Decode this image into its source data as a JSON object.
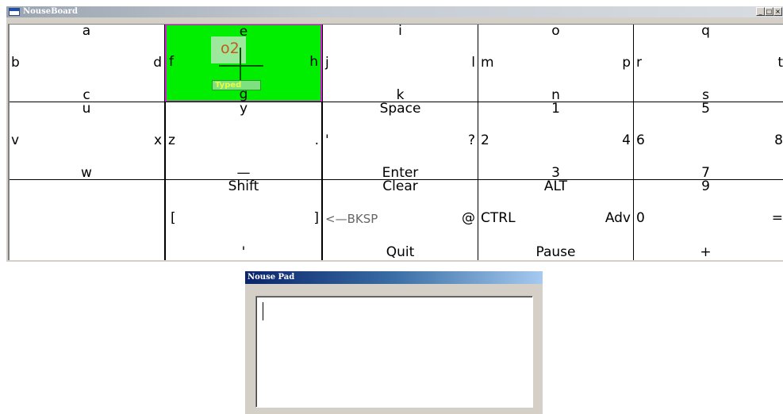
{
  "board_window": {
    "title": "NouseBoard",
    "controls": {
      "minimize": "_",
      "maximize": "□",
      "close": "×"
    }
  },
  "keyboard": {
    "rows": [
      [
        {
          "top": "a",
          "left": "b",
          "right": "d",
          "bottom": "c"
        },
        {
          "top": "e",
          "left": "f",
          "right": "h",
          "bottom": "g",
          "active": true
        },
        {
          "top": "i",
          "left": "j",
          "right": "l",
          "bottom": "k"
        },
        {
          "top": "o",
          "left": "m",
          "right": "p",
          "bottom": "n"
        },
        {
          "top": "q",
          "left": "r",
          "right": "t",
          "bottom": "s"
        }
      ],
      [
        {
          "top": "u",
          "left": "v",
          "right": "x",
          "bottom": "w"
        },
        {
          "top": "y",
          "left": "z",
          "right": ".",
          "bottom": "—"
        },
        {
          "top": "Space",
          "left": "'",
          "right": "?",
          "bottom": "Enter"
        },
        {
          "top": "1",
          "left": "2",
          "right": "4",
          "bottom": "3"
        },
        {
          "top": "5",
          "left": "6",
          "right": "8",
          "bottom": "7"
        }
      ],
      [
        {
          "top": "",
          "left": "",
          "right": "",
          "bottom": ""
        },
        {
          "top": "Shift",
          "left": "[",
          "right": "]",
          "bottom": "'"
        },
        {
          "top": "Clear",
          "left": "<—BKSP",
          "right": "@",
          "bottom": "Quit"
        },
        {
          "top": "ALT",
          "left": "CTRL",
          "right": "Adv",
          "bottom": "Pause"
        },
        {
          "top": "9",
          "left": "0",
          "right": "=",
          "bottom": "+"
        }
      ]
    ],
    "cursor": {
      "typed_label": "Typed",
      "annotation": "o2"
    }
  },
  "pad_window": {
    "title": "Nouse Pad",
    "text": ""
  },
  "colors": {
    "active_key": "#00ee00",
    "active_border": "#d020d0",
    "titlebar_active": "#0a246a",
    "annotation": "#c45a1a"
  }
}
